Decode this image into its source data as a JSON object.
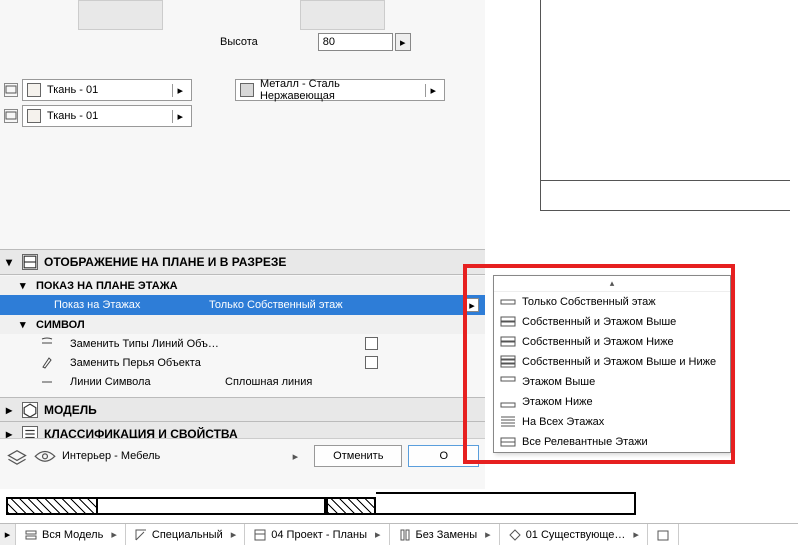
{
  "top": {
    "height_label": "Высота",
    "height_value": "80"
  },
  "materials": {
    "fabric1": "Ткань - 01",
    "fabric2": "Ткань - 01",
    "steel": "Металл - Сталь Нержавеющая"
  },
  "sections": {
    "display_header": "ОТОБРАЖЕНИЕ НА ПЛАНЕ И В РАЗРЕЗЕ",
    "plan_header": "ПОКАЗ НА ПЛАНЕ ЭТАЖА",
    "symbol_header": "СИМВОЛ",
    "model_header": "МОДЕЛЬ",
    "class_header": "КЛАССИФИКАЦИЯ И СВОЙСТВА"
  },
  "highlighted": {
    "label": "Показ на Этажах",
    "value": "Только Собственный этаж"
  },
  "props": [
    {
      "label": "Заменить Типы Линий Объ…",
      "value": ""
    },
    {
      "label": "Заменить Перья Объекта",
      "value": ""
    },
    {
      "label": "Линии Символа",
      "value": "Сплошная линия"
    }
  ],
  "footer": {
    "layer": "Интерьер - Мебель",
    "cancel": "Отменить",
    "ok": "О"
  },
  "dropdown": {
    "items": [
      "Только Собственный этаж",
      "Собственный и Этажом Выше",
      "Собственный и Этажом Ниже",
      "Собственный и Этажом Выше и Ниже",
      "Этажом Выше",
      "Этажом Ниже",
      "На Всех Этажах",
      "Все Релевантные Этажи"
    ]
  },
  "tabs": {
    "t1": "Вся Модель",
    "t2": "Специальный",
    "t3": "04 Проект - Планы",
    "t4": "Без Замены",
    "t5": "01 Существующе…"
  }
}
